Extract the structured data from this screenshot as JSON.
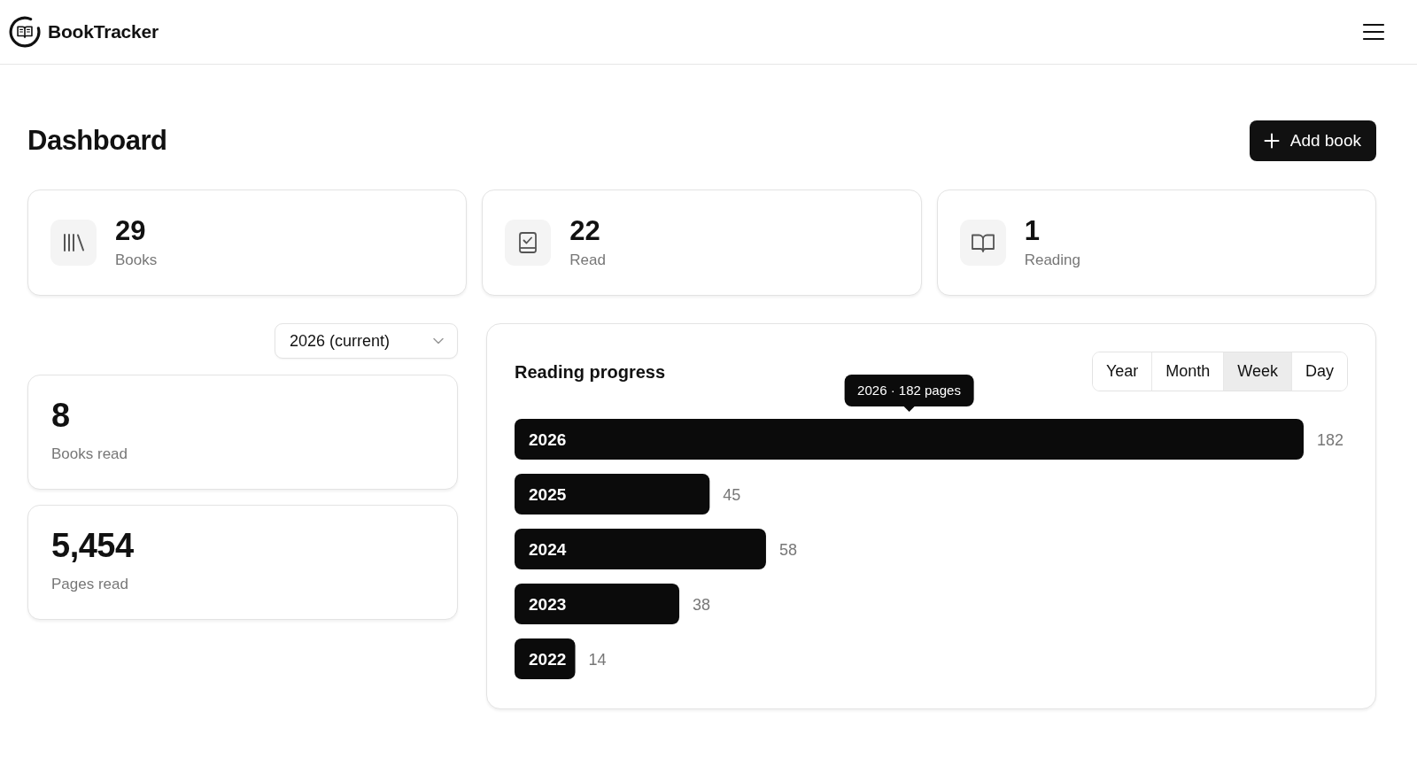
{
  "navbar": {
    "brand": "BookTracker"
  },
  "header": {
    "title": "Dashboard",
    "add_button": "Add book"
  },
  "stats": [
    {
      "kind": "books",
      "value": "29",
      "label": "Books"
    },
    {
      "kind": "read",
      "value": "22",
      "label": "Read"
    },
    {
      "kind": "reading",
      "value": "1",
      "label": "Reading"
    }
  ],
  "year_filter": {
    "value": "2026 (current)"
  },
  "summary": [
    {
      "value": "8",
      "label": "Books read"
    },
    {
      "value": "5,454",
      "label": "Pages read"
    }
  ],
  "reading_progress": {
    "title": "Reading progress",
    "periods": [
      {
        "label": "Year",
        "selected": false
      },
      {
        "label": "Month",
        "selected": false
      },
      {
        "label": "Week",
        "selected": true
      },
      {
        "label": "Day",
        "selected": false
      }
    ],
    "chart_data": {
      "type": "bar",
      "orientation": "horizontal",
      "categories": [
        "2026",
        "2025",
        "2024",
        "2023",
        "2022"
      ],
      "values": [
        182,
        45,
        58,
        38,
        14
      ],
      "data_labels": true,
      "annotations": [
        "2026 · 182 pages"
      ]
    }
  }
}
